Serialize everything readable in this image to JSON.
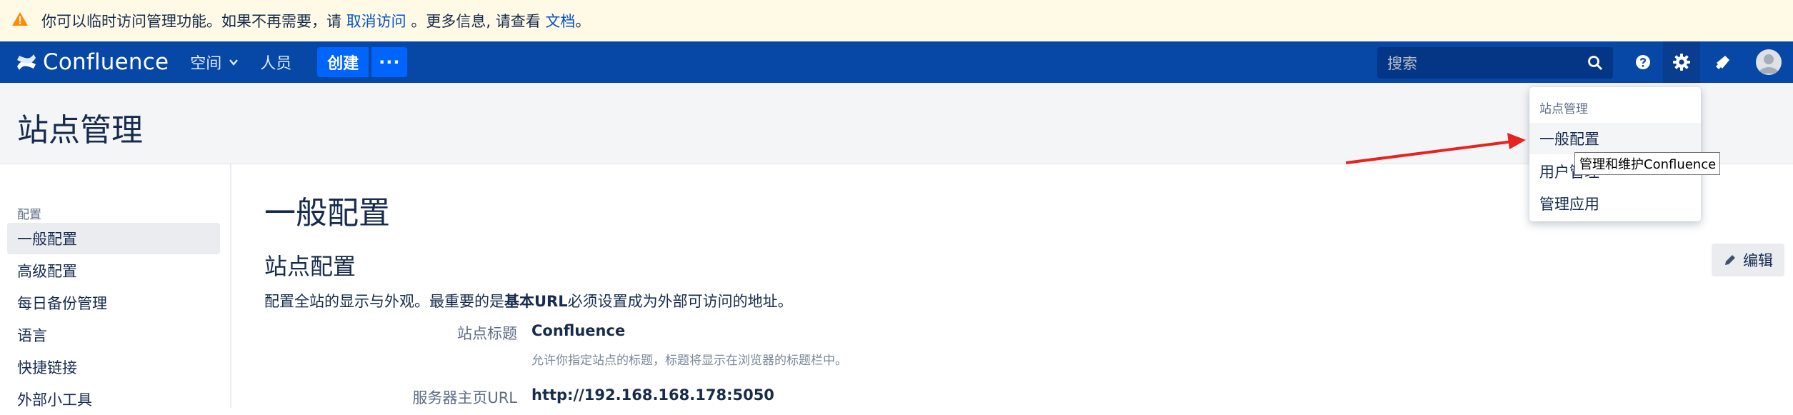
{
  "banner": {
    "text_before": "你可以临时访问管理功能。如果不再需要，请 ",
    "link_cancel": "取消访问",
    "text_middle": " 。更多信息, 请查看 ",
    "link_docs": "文档",
    "text_after": "。"
  },
  "nav": {
    "brand": "Confluence",
    "spaces": "空间",
    "people": "人员",
    "create": "创建",
    "more": "···",
    "search_placeholder": "搜索"
  },
  "page": {
    "title": "站点管理"
  },
  "sidebar": {
    "section": "配置",
    "items": [
      {
        "label": "一般配置"
      },
      {
        "label": "高级配置"
      },
      {
        "label": "每日备份管理"
      },
      {
        "label": "语言"
      },
      {
        "label": "快捷链接"
      },
      {
        "label": "外部小工具"
      }
    ]
  },
  "main": {
    "title": "一般配置",
    "section_title": "站点配置",
    "desc_before": "配置全站的显示与外观。最重要的是",
    "desc_bold": "基本URL",
    "desc_after": "必须设置成为外部可访问的地址。",
    "edit_label": "编辑",
    "fields": [
      {
        "label": "站点标题",
        "value": "Confluence",
        "help": "允许你指定站点的标题，标题将显示在浏览器的标题栏中。"
      },
      {
        "label": "服务器主页URL",
        "value": "http://192.168.168.178:5050"
      }
    ]
  },
  "dropdown": {
    "heading": "站点管理",
    "items": [
      {
        "label": "一般配置"
      },
      {
        "label": "用户管理"
      },
      {
        "label": "管理应用"
      }
    ]
  },
  "tooltip": "管理和维护Confluence",
  "colors": {
    "nav_bg": "#0747a6",
    "accent": "#0065ff",
    "banner_bg": "#fffae6",
    "warning": "#ff8b00",
    "annotation_arrow": "#e8231f"
  }
}
